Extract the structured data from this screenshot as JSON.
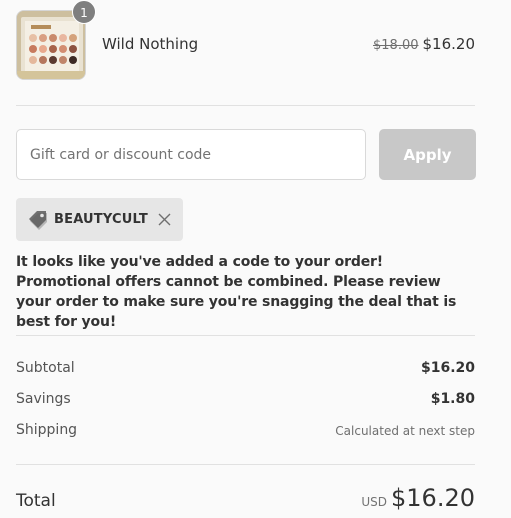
{
  "line_item": {
    "quantity": "1",
    "name": "Wild Nothing",
    "original_price": "$18.00",
    "price": "$16.20"
  },
  "discount": {
    "placeholder": "Gift card or discount code",
    "apply_label": "Apply",
    "applied_code": "BEAUTYCULT",
    "note": "It looks like you've added a code to your order! Promotional offers cannot be combined. Please review your order to make sure you're snagging the deal that is best for you!"
  },
  "summary": {
    "subtotal_label": "Subtotal",
    "subtotal_value": "$16.20",
    "savings_label": "Savings",
    "savings_value": "$1.80",
    "shipping_label": "Shipping",
    "shipping_value": "Calculated at next step",
    "total_label": "Total",
    "currency": "USD",
    "total_value": "$16.20"
  }
}
